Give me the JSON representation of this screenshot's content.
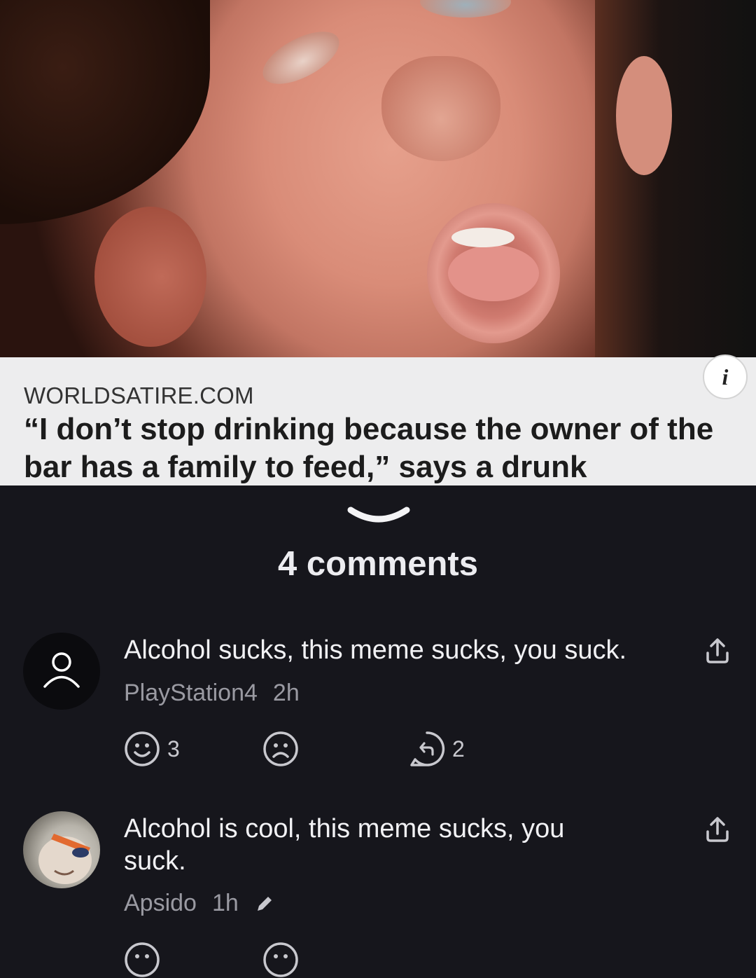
{
  "post": {
    "source": "WORLDSATIRE.COM",
    "headline": "“I don’t stop drinking because the owner of the bar has a family to feed,” says a drunk",
    "info_label": "i"
  },
  "comments_header": {
    "count_label": "4 comments"
  },
  "comments": [
    {
      "text": "Alcohol sucks, this meme sucks, you suck.",
      "author": "PlayStation4",
      "time": "2h",
      "likes": "3",
      "replies": "2",
      "avatar": "default-user-icon"
    },
    {
      "text": "Alcohol is cool, this meme sucks, you suck.",
      "author": "Apsido",
      "time": "1h",
      "avatar": "user-photo",
      "edited_icon": "pencil-icon"
    }
  ],
  "colors": {
    "background": "#16161c",
    "caption_bg": "#ededee",
    "meta_text": "#9a9aa2",
    "icon": "#c8c8ce"
  }
}
